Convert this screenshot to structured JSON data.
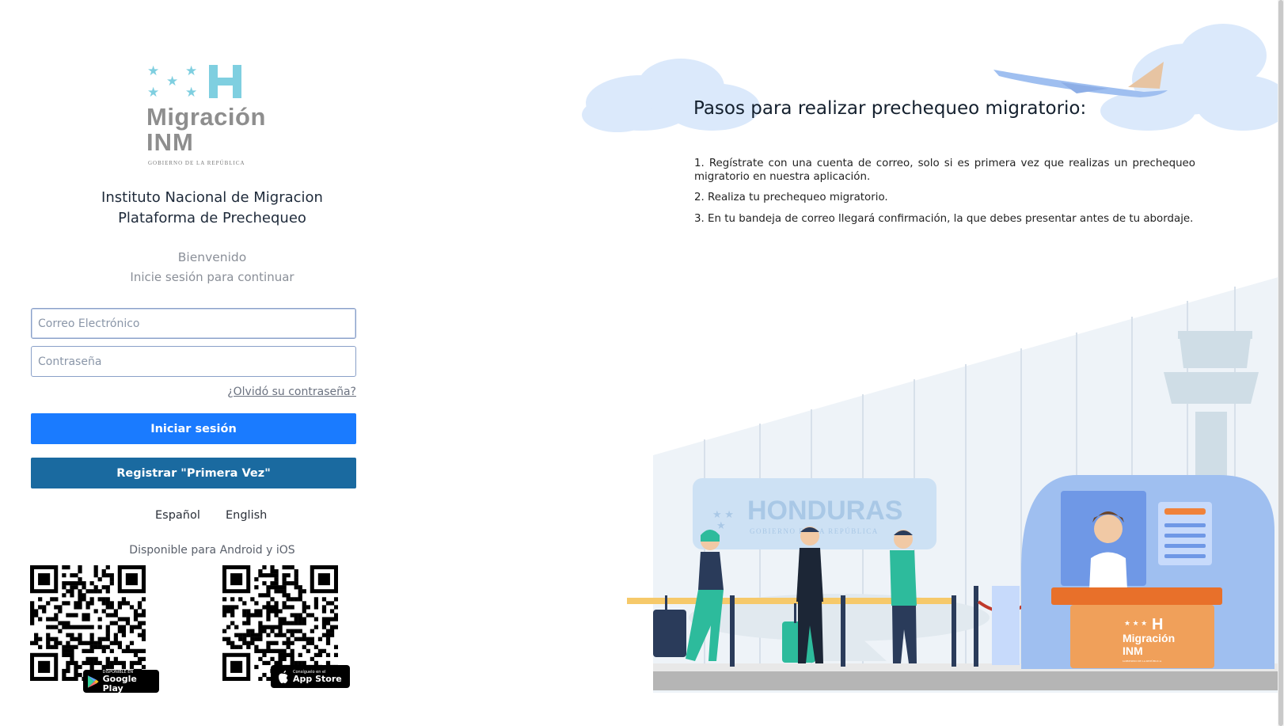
{
  "logo": {
    "line1": "Migración",
    "line2": "INM",
    "tagline": "GOBIERNO DE LA REPÚBLICA",
    "colors": {
      "stars": "#7fcfe0",
      "wordmark": "#8e8e8e"
    }
  },
  "header": {
    "institution": "Instituto Nacional de Migracion",
    "platform": "Plataforma de Prechequeo",
    "welcome": "Bienvenido",
    "subtitle": "Inicie sesión para continuar"
  },
  "form": {
    "email_placeholder": "Correo Electrónico",
    "email_value": "",
    "password_placeholder": "Contraseña",
    "password_value": "",
    "forgot_label": "¿Olvidó su contraseña?",
    "login_label": "Iniciar sesión",
    "register_label": "Registrar \"Primera Vez\"",
    "colors": {
      "login": "#1a7bff",
      "register": "#1a6aa0"
    }
  },
  "languages": [
    "Español",
    "English"
  ],
  "apps": {
    "available_text": "Disponible para Android y iOS",
    "android_badge_small": "DISPONIBLE EN",
    "android_badge_big": "Google Play",
    "ios_badge_small": "Consíguelo en el",
    "ios_badge_big": "App Store"
  },
  "steps": {
    "title": "Pasos para realizar prechequeo migratorio:",
    "items": [
      "1. Regístrate con una cuenta de correo, solo si es primera vez que realizas un prechequeo migratorio en nuestra aplicación.",
      "2. Realiza tu prechequeo migratorio.",
      "3. En tu bandeja de correo llegará confirmación, la que debes presentar antes de tu abordaje."
    ]
  },
  "illustration": {
    "banner_text": "HONDURAS",
    "banner_sub": "GOBIERNO DE LA REPÚBLICA",
    "booth_logo_line1": "Migración",
    "booth_logo_line2": "INM",
    "booth_logo_sub": "GOBIERNO DE LA REPÚBLICA"
  }
}
